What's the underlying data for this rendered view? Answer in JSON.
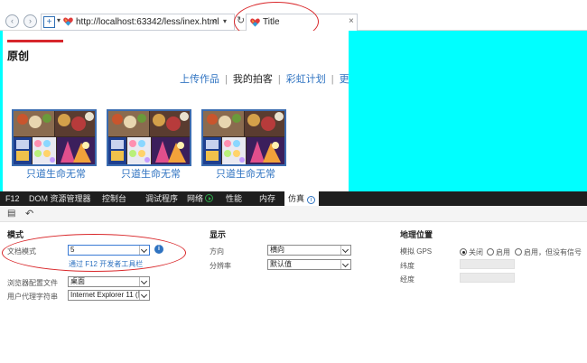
{
  "browser": {
    "address": {
      "prefix_icon": "compatibility-icon",
      "url": "http://localhost:63342/less/inex.html"
    },
    "tab": {
      "title": "Title",
      "close": "×"
    },
    "icons": {
      "back": "‹",
      "forward": "›",
      "search": "⌕",
      "refresh": "↻"
    }
  },
  "page": {
    "heading": "原创",
    "nav": [
      {
        "label": "上传作品",
        "current": false
      },
      {
        "label": "我的拍客",
        "current": true
      },
      {
        "label": "彩虹计划",
        "current": false
      },
      {
        "label": "更多哦",
        "current": false
      }
    ],
    "nav_separator": "|",
    "cards": [
      {
        "caption": "只道生命无常"
      },
      {
        "caption": "只道生命无常"
      },
      {
        "caption": "只道生命无常"
      }
    ]
  },
  "devtools": {
    "tabs": [
      {
        "label": "F12",
        "active": false
      },
      {
        "label": "DOM 资源管理器",
        "active": false
      },
      {
        "label": "控制台",
        "active": false
      },
      {
        "label": "调试程序",
        "active": false
      },
      {
        "label": "网络",
        "active": false
      },
      {
        "label": "性能",
        "active": false
      },
      {
        "label": "内存",
        "active": false
      },
      {
        "label": "仿真",
        "active": true
      }
    ],
    "mode": {
      "title": "模式",
      "doc_mode_label": "文档模式",
      "doc_mode_value": "5",
      "doc_mode_info": "i",
      "doc_mode_link": "通过 F12 开发者工具栏",
      "browser_profile_label": "浏览器配置文件",
      "browser_profile_value": "桌面",
      "ua_label": "用户代理字符串",
      "ua_value": "Internet Explorer 11 (默"
    },
    "display": {
      "title": "显示",
      "orientation_label": "方向",
      "orientation_value": "横向",
      "resolution_label": "分辨率",
      "resolution_value": "默认值"
    },
    "geo": {
      "title": "地理位置",
      "gps_label": "模拟 GPS",
      "gps_options": [
        {
          "label": "关闭",
          "selected": true
        },
        {
          "label": "启用",
          "selected": false
        },
        {
          "label": "启用，但没有信号",
          "selected": false
        }
      ],
      "latitude_label": "纬度",
      "longitude_label": "经度"
    }
  },
  "colors": {
    "accent_red": "#d7262c",
    "viewport_bg": "#00ffff",
    "link_blue": "#2f73c1",
    "annotation_red": "#d9272a"
  }
}
